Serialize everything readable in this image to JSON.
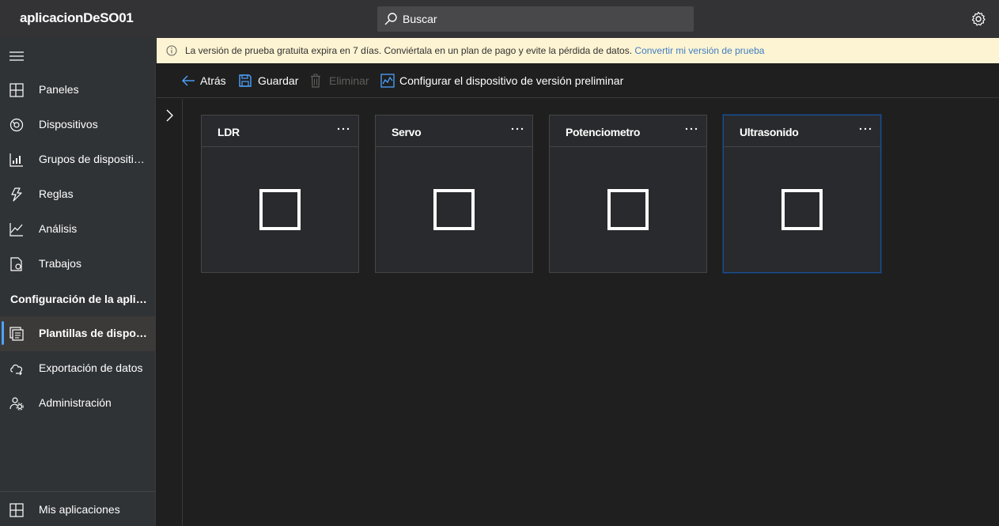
{
  "app": {
    "title": "aplicacionDeSO01"
  },
  "search": {
    "placeholder": "Buscar",
    "icon": "search-icon"
  },
  "header": {
    "settings_icon": "gear-icon"
  },
  "sidebar": {
    "menu_icon": "hamburger-icon",
    "items": [
      {
        "label": "Paneles",
        "icon": "dashboard-icon"
      },
      {
        "label": "Dispositivos",
        "icon": "devices-icon"
      },
      {
        "label": "Grupos de dispositivos",
        "icon": "device-groups-icon"
      },
      {
        "label": "Reglas",
        "icon": "rules-icon"
      },
      {
        "label": "Análisis",
        "icon": "analytics-icon"
      },
      {
        "label": "Trabajos",
        "icon": "jobs-icon"
      }
    ],
    "section_title": "Configuración de la aplicación",
    "config_items": [
      {
        "label": "Plantillas de dispositivo",
        "icon": "device-templates-icon",
        "active": true
      },
      {
        "label": "Exportación de datos",
        "icon": "data-export-icon"
      },
      {
        "label": "Administración",
        "icon": "administration-icon"
      }
    ],
    "footer_item": {
      "label": "Mis aplicaciones",
      "icon": "my-apps-icon"
    }
  },
  "banner": {
    "text": "La versión de prueba gratuita expira en 7 días. Conviértala en un plan de pago y evite la pérdida de datos.",
    "link": "Convertir mi versión de prueba",
    "icon": "info-icon"
  },
  "toolbar": {
    "back": "Atrás",
    "save": "Guardar",
    "delete": "Eliminar",
    "configure_preview": "Configurar el dispositivo de versión preliminar"
  },
  "cards": [
    {
      "title": "LDR"
    },
    {
      "title": "Servo"
    },
    {
      "title": "Potenciometro"
    },
    {
      "title": "Ultrasonido",
      "selected": true
    }
  ],
  "colors": {
    "accent": "#4da3ff",
    "banner_bg": "#fdf4d3",
    "banner_link": "#3f7ec2",
    "sidebar_bg": "#303336",
    "topbar_bg": "#333234",
    "canvas_bg": "#1f1f1f"
  }
}
